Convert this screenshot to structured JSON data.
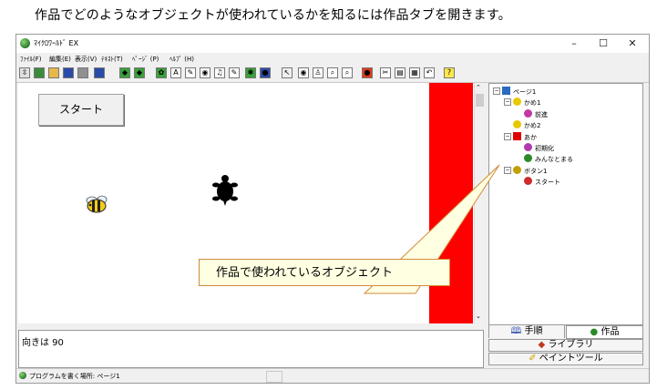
{
  "caption": "作品でどのようなオブジェクトが使われているかを知るには作品タブを開きます。",
  "window": {
    "title": "ﾏｲｸﾛﾜｰﾙﾄﾞ EX",
    "minimize": "–",
    "maximize": "☐",
    "close": "✕"
  },
  "menu": [
    "ﾌｧｲﾙ(F)",
    "編集(E)",
    "表示(V)",
    "ﾃｷｽﾄ(T)",
    "ﾍﾟｰｼﾞ (P)",
    "ﾍﾙﾌﾟ (H)"
  ],
  "toolbar_icons": [
    {
      "name": "toolbar-pin-icon",
      "glyph": "⇳",
      "color": "#e0e0e0"
    },
    {
      "name": "toolbar-world-icon",
      "glyph": "",
      "color": "#3a8c3a"
    },
    {
      "name": "toolbar-open-icon",
      "glyph": "",
      "color": "#e8b84a"
    },
    {
      "name": "toolbar-save-icon",
      "glyph": "",
      "color": "#2a4aa8"
    },
    {
      "name": "toolbar-print-icon",
      "glyph": "",
      "color": "#909090"
    },
    {
      "name": "toolbar-grid-icon",
      "glyph": "",
      "color": "#2a4aa8"
    },
    {
      "name": "toolbar-back-icon",
      "glyph": "◆",
      "color": "#3aa03a"
    },
    {
      "name": "toolbar-forward-icon",
      "glyph": "◆",
      "color": "#3aa03a"
    },
    {
      "name": "toolbar-turtle-icon",
      "glyph": "✿",
      "color": "#3aa03a"
    },
    {
      "name": "toolbar-text-icon",
      "glyph": "A",
      "color": "#ffffff"
    },
    {
      "name": "toolbar-brush-icon",
      "glyph": "✎",
      "color": "#ffffff"
    },
    {
      "name": "toolbar-eye-icon",
      "glyph": "◉",
      "color": "#ffffff"
    },
    {
      "name": "toolbar-music-icon",
      "glyph": "♫",
      "color": "#ffffff"
    },
    {
      "name": "toolbar-draw-icon",
      "glyph": "✎",
      "color": "#ffffff"
    },
    {
      "name": "toolbar-puzzle-icon",
      "glyph": "✱",
      "color": "#3aa03a"
    },
    {
      "name": "toolbar-globe-icon",
      "glyph": "●",
      "color": "#2a4aa8"
    },
    {
      "name": "toolbar-pointer-icon",
      "glyph": "↖",
      "color": "#f0f0f0"
    },
    {
      "name": "toolbar-view-icon",
      "glyph": "◉",
      "color": "#ffffff"
    },
    {
      "name": "toolbar-person-icon",
      "glyph": "♙",
      "color": "#ffffff"
    },
    {
      "name": "toolbar-zoom-in-icon",
      "glyph": "⌕",
      "color": "#ffffff"
    },
    {
      "name": "toolbar-zoom-out-icon",
      "glyph": "⌕",
      "color": "#ffffff"
    },
    {
      "name": "toolbar-stop-icon",
      "glyph": "●",
      "color": "#e03a1a"
    },
    {
      "name": "toolbar-cut-icon",
      "glyph": "✂",
      "color": "#ffffff"
    },
    {
      "name": "toolbar-copy-icon",
      "glyph": "▤",
      "color": "#ffffff"
    },
    {
      "name": "toolbar-paste-icon",
      "glyph": "▦",
      "color": "#ffffff"
    },
    {
      "name": "toolbar-undo-icon",
      "glyph": "↶",
      "color": "#ffffff"
    },
    {
      "name": "toolbar-help-icon",
      "glyph": "?",
      "color": "#ffe84a"
    }
  ],
  "stage": {
    "start_button": "スタート",
    "wall_color": "#ff0000"
  },
  "callout": {
    "text": "作品で使われているオブジェクト",
    "border_color": "#d08a3a",
    "fill_color": "#ffffe1"
  },
  "tree": [
    {
      "label": "ページ1",
      "level": 0,
      "toggle": "⊟",
      "icon": "page-icon",
      "color": "#2a6ac0"
    },
    {
      "label": "かめ1",
      "level": 1,
      "toggle": "⊟",
      "icon": "turtle-star-icon",
      "color": "#e8c800"
    },
    {
      "label": "前進",
      "level": 2,
      "toggle": "",
      "icon": "goggles-icon",
      "color": "#c03aa0"
    },
    {
      "label": "かめ2",
      "level": 1,
      "toggle": "",
      "icon": "turtle-star-icon",
      "color": "#e8c800"
    },
    {
      "label": "あか",
      "level": 1,
      "toggle": "⊟",
      "icon": "red-square-icon",
      "color": "#e00000"
    },
    {
      "label": "初期化",
      "level": 2,
      "toggle": "",
      "icon": "gears-icon",
      "color": "#b03ab0"
    },
    {
      "label": "みんなとまる",
      "level": 2,
      "toggle": "",
      "icon": "bug-icon",
      "color": "#2a8a2a"
    },
    {
      "label": "ボタン1",
      "level": 1,
      "toggle": "⊟",
      "icon": "button-icon",
      "color": "#c0a000"
    },
    {
      "label": "スタート",
      "level": 2,
      "toggle": "",
      "icon": "runner-icon",
      "color": "#d02a2a"
    }
  ],
  "status_panel": {
    "text": "向きは 90"
  },
  "tabs": {
    "steps": "手順",
    "works": "作品",
    "library": "ライブラリ",
    "paint": "ペイントツール"
  },
  "statusbar": {
    "text": "プログラムを書く場所: ページ1"
  }
}
